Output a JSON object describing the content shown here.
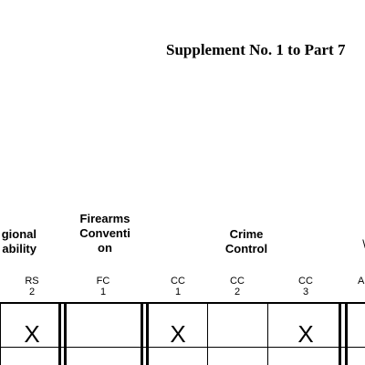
{
  "document": {
    "title": "Supplement No. 1 to Part 7",
    "groups": [
      {
        "label": "gional\nability"
      },
      {
        "label": "Firearms\nConventi\non"
      },
      {
        "label": "Crime\nControl"
      },
      {
        "label": "\\"
      }
    ],
    "columns": [
      {
        "code": "RS\n2",
        "mark": "X"
      },
      {
        "code": "FC\n1",
        "mark": ""
      },
      {
        "code": "CC\n1",
        "mark": "X"
      },
      {
        "code": "CC\n2",
        "mark": ""
      },
      {
        "code": "CC\n3",
        "mark": "X"
      },
      {
        "code": "A",
        "mark": ""
      }
    ]
  }
}
